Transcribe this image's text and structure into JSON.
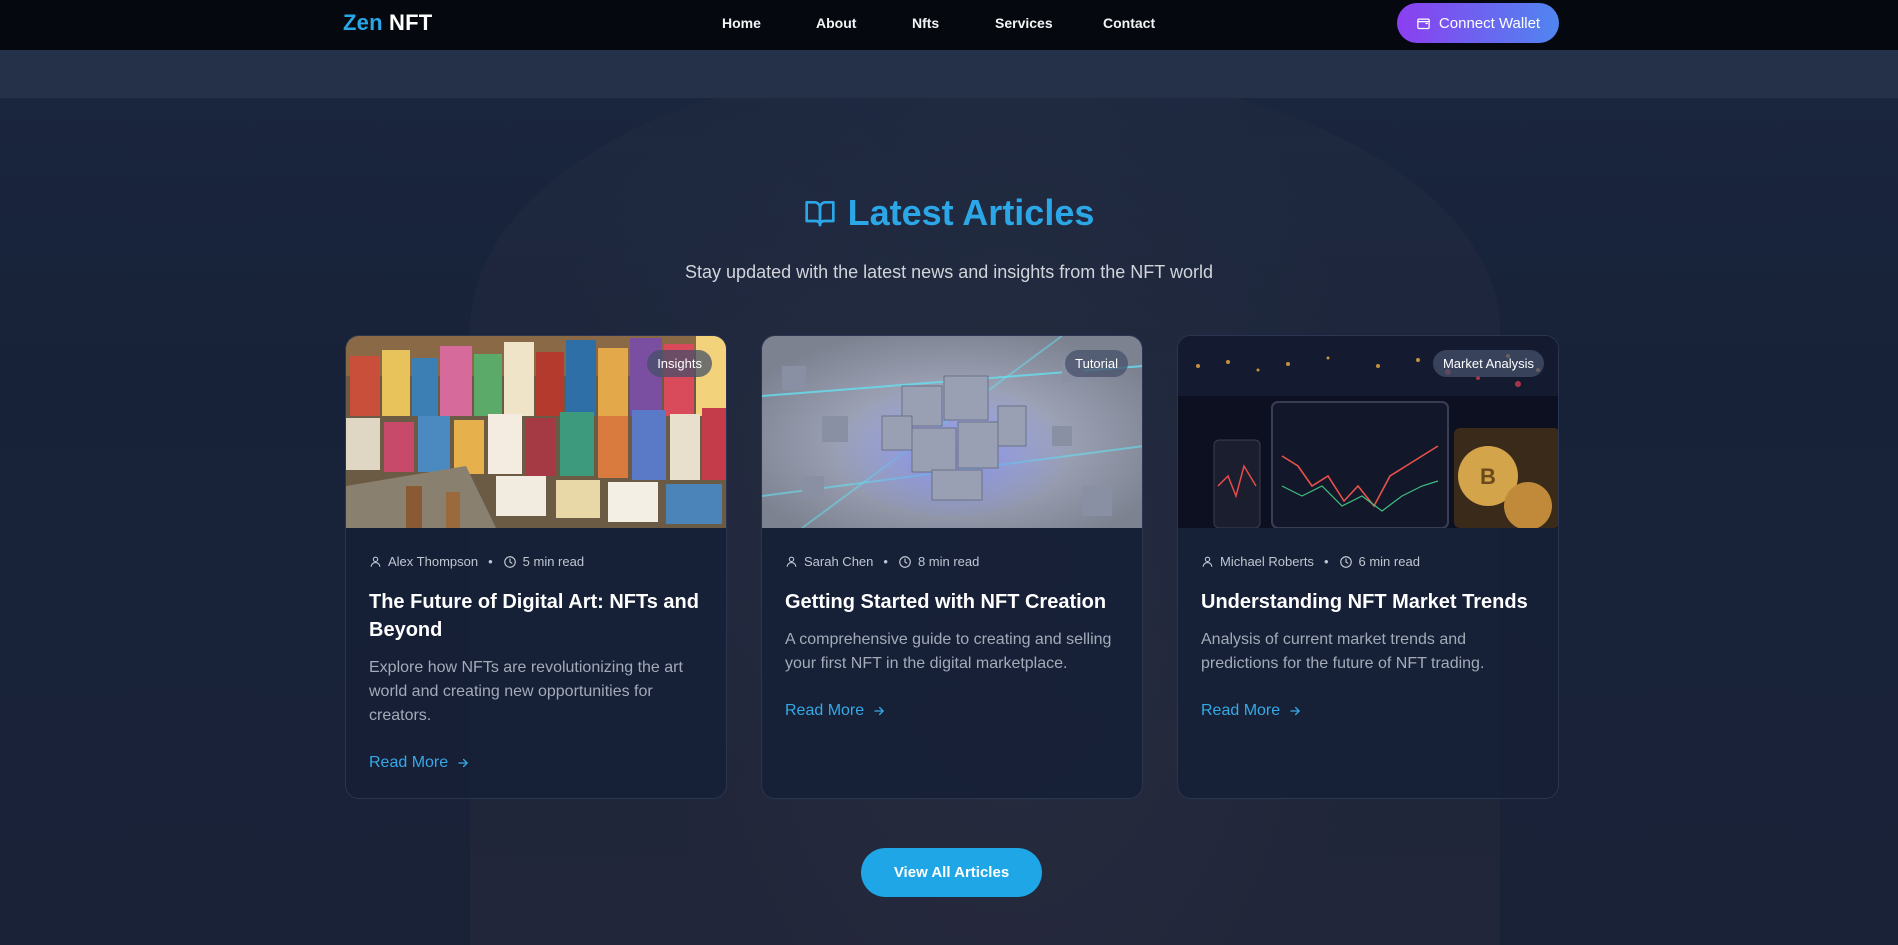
{
  "nav": {
    "logo_zen": "Zen",
    "logo_nft": "NFT",
    "links": [
      "Home",
      "About",
      "Nfts",
      "Services",
      "Contact"
    ],
    "wallet_label": "Connect Wallet"
  },
  "section": {
    "title": "Latest Articles",
    "subtitle": "Stay updated with the latest news and insights from the NFT world"
  },
  "articles": [
    {
      "category": "Insights",
      "author": "Alex Thompson",
      "read_time": "5 min read",
      "title": "The Future of Digital Art: NFTs and Beyond",
      "excerpt": "Explore how NFTs are revolutionizing the art world and creating new opportunities for creators.",
      "read_more": "Read More"
    },
    {
      "category": "Tutorial",
      "author": "Sarah Chen",
      "read_time": "8 min read",
      "title": "Getting Started with NFT Creation",
      "excerpt": "A comprehensive guide to creating and selling your first NFT in the digital marketplace.",
      "read_more": "Read More"
    },
    {
      "category": "Market Analysis",
      "author": "Michael Roberts",
      "read_time": "6 min read",
      "title": "Understanding NFT Market Trends",
      "excerpt": "Analysis of current market trends and predictions for the future of NFT trading.",
      "read_more": "Read More"
    }
  ],
  "view_all_label": "View All Articles",
  "colors": {
    "accent": "#29a8e8",
    "wallet_gradient_start": "#8b3ff0",
    "wallet_gradient_end": "#4f86f0",
    "background": "#17223a",
    "nav_background": "#05080f"
  },
  "icons": {
    "title": "book-open-icon",
    "wallet": "wallet-icon",
    "author": "user-icon",
    "time": "clock-icon",
    "read_more": "arrow-right-icon"
  }
}
